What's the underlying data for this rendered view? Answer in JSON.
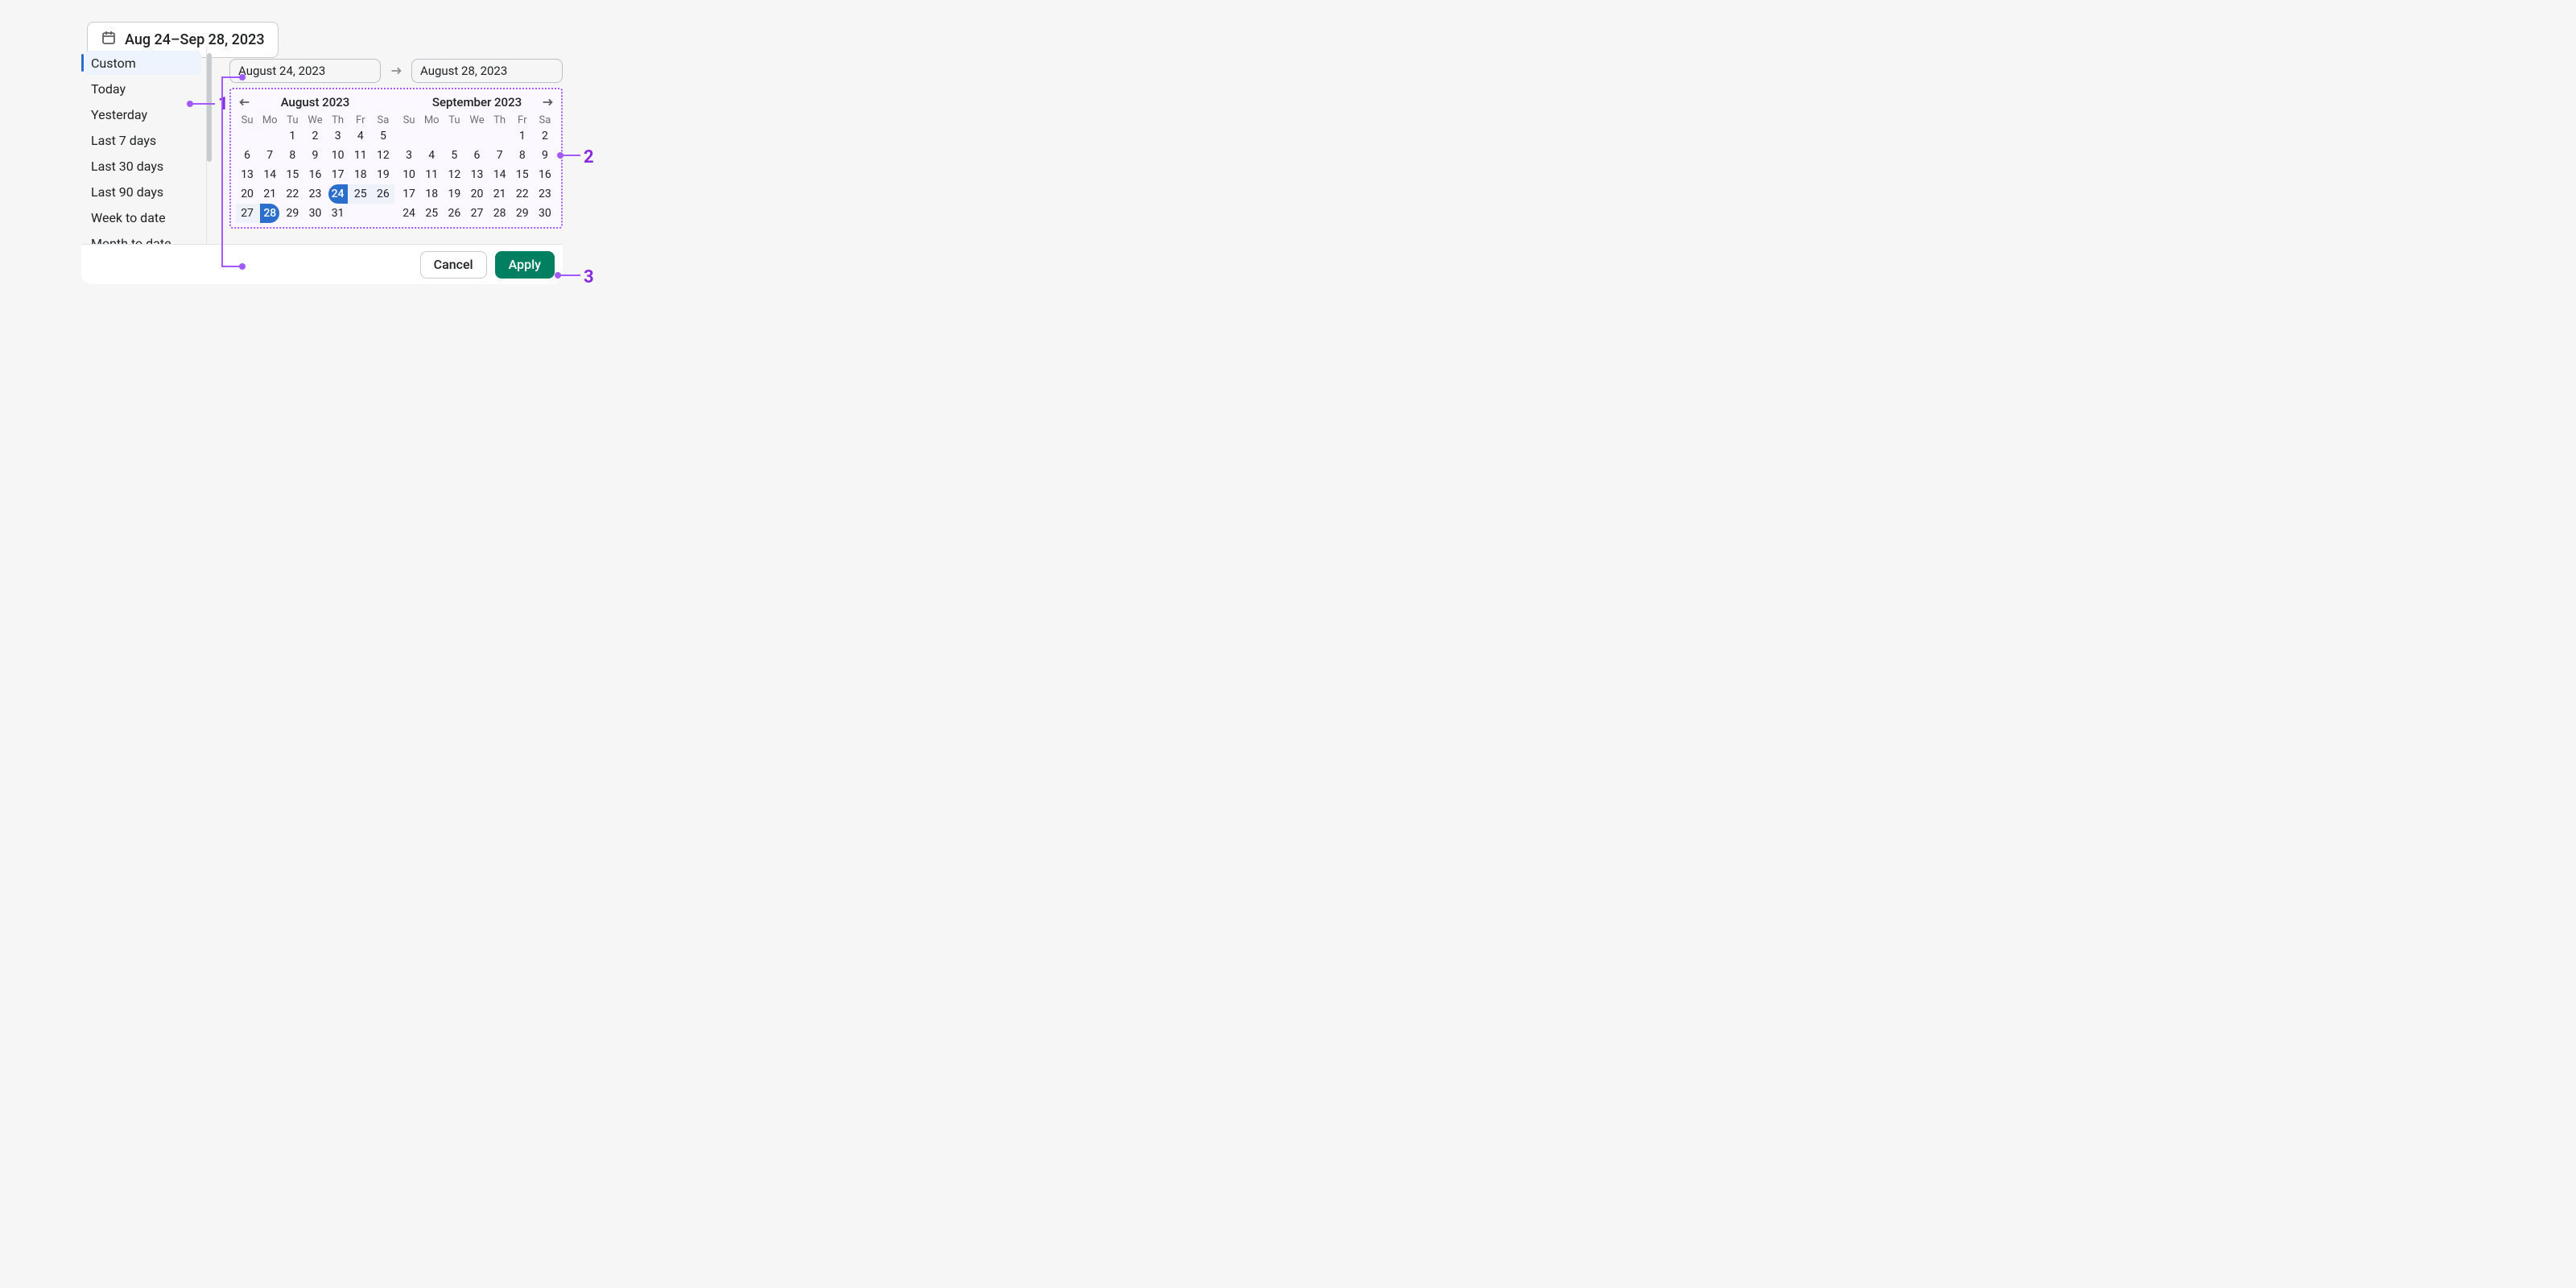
{
  "trigger": {
    "label": "Aug 24–Sep 28, 2023"
  },
  "presets": [
    {
      "label": "Custom",
      "active": true
    },
    {
      "label": "Today"
    },
    {
      "label": "Yesterday"
    },
    {
      "label": "Last 7 days"
    },
    {
      "label": "Last 30 days"
    },
    {
      "label": "Last 90 days"
    },
    {
      "label": "Week to date"
    },
    {
      "label": "Month to date"
    }
  ],
  "inputs": {
    "from": "August 24, 2023",
    "to": "August 28, 2023"
  },
  "dow": [
    "Su",
    "Mo",
    "Tu",
    "We",
    "Th",
    "Fr",
    "Sa"
  ],
  "month_left": {
    "title": "August 2023",
    "offset": 2,
    "days": 31,
    "range_start": 24,
    "range_end": 28
  },
  "month_right": {
    "title": "September 2023",
    "offset": 5,
    "days": 30
  },
  "footer": {
    "cancel": "Cancel",
    "apply": "Apply"
  },
  "annotations": {
    "n1": "1",
    "n2": "2",
    "n3": "3"
  },
  "colors": {
    "accent": "#2c6ecb",
    "primary": "#008060",
    "annotation": "#a259ff"
  }
}
